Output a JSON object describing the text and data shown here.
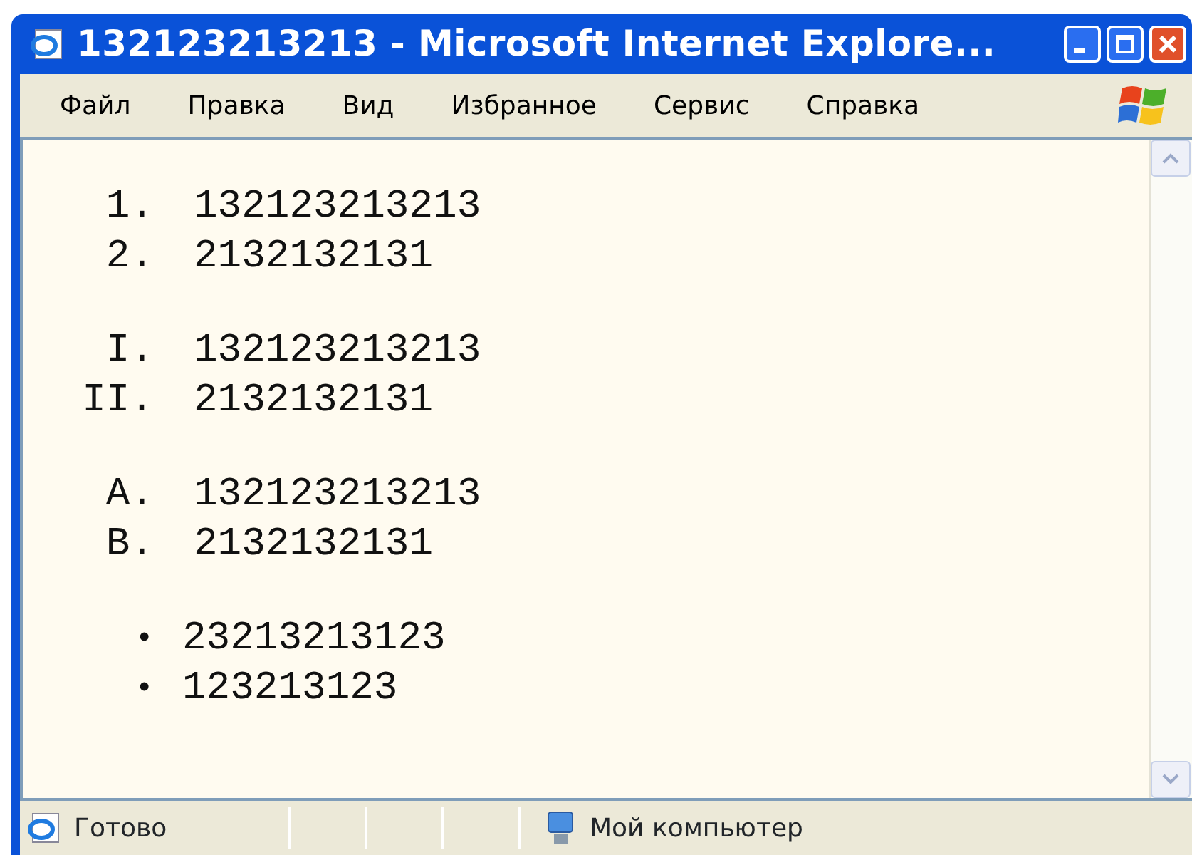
{
  "window": {
    "title": "132123213213 - Microsoft Internet Explore..."
  },
  "menu": [
    "Файл",
    "Правка",
    "Вид",
    "Избранное",
    "Сервис",
    "Справка"
  ],
  "lists": [
    {
      "kind": "ordered",
      "items": [
        {
          "marker": "1.",
          "text": "132123213213"
        },
        {
          "marker": "2.",
          "text": "2132132131"
        }
      ]
    },
    {
      "kind": "ordered",
      "items": [
        {
          "marker": "I.",
          "text": "132123213213"
        },
        {
          "marker": "II.",
          "text": "2132132131"
        }
      ]
    },
    {
      "kind": "ordered",
      "items": [
        {
          "marker": "A.",
          "text": "132123213213"
        },
        {
          "marker": "B.",
          "text": "2132132131"
        }
      ]
    },
    {
      "kind": "bullet",
      "items": [
        {
          "marker": "•",
          "text": "23213213123"
        },
        {
          "marker": "•",
          "text": "123213123"
        }
      ]
    }
  ],
  "status_bar": {
    "status": "Готово",
    "zone": "Мой компьютер"
  }
}
